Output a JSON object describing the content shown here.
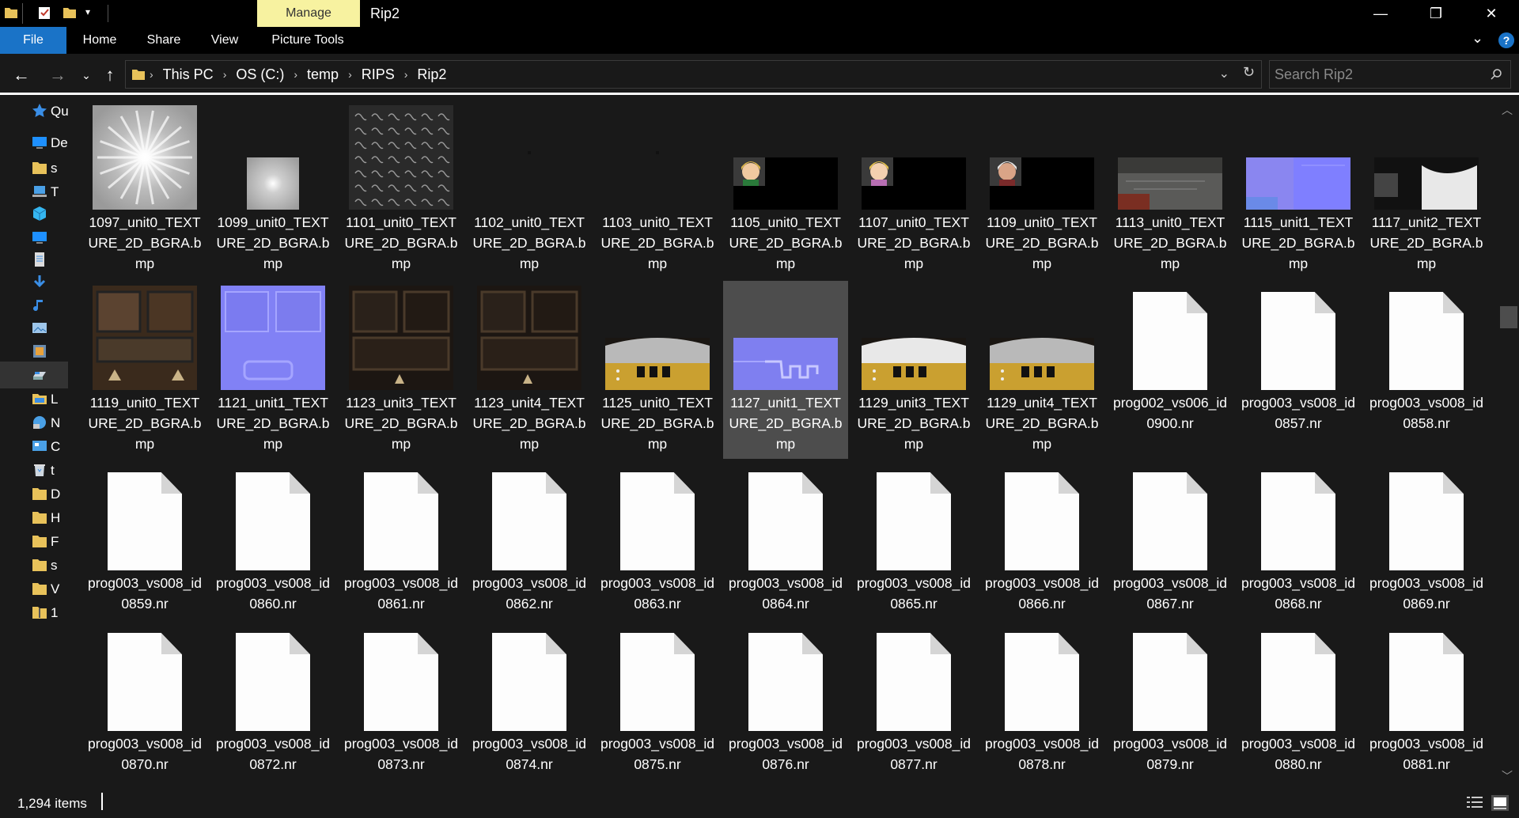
{
  "window": {
    "title": "Rip2",
    "context_tab": "Manage",
    "minimize_glyph": "—",
    "maximize_glyph": "❐",
    "close_glyph": "✕"
  },
  "ribbon": {
    "tabs": [
      "File",
      "Home",
      "Share",
      "View",
      "Picture Tools"
    ]
  },
  "address": {
    "breadcrumbs": [
      "This PC",
      "OS (C:)",
      "temp",
      "RIPS",
      "Rip2"
    ],
    "search_placeholder": "Search Rip2"
  },
  "nav": {
    "items": [
      {
        "label": "Qu",
        "icon": "star-icon",
        "color": "#3a8ee6"
      },
      {
        "label": "De",
        "icon": "desktop-icon",
        "color": "#1e90ff"
      },
      {
        "label": "s",
        "icon": "folder-icon",
        "color": "#e8c25a"
      },
      {
        "label": "T",
        "icon": "computer-icon",
        "color": "#4aa0e6"
      },
      {
        "label": "",
        "icon": "3d-objects-icon",
        "color": "#35b6f0"
      },
      {
        "label": "",
        "icon": "desktop-icon",
        "color": "#1e90ff"
      },
      {
        "label": "",
        "icon": "documents-icon",
        "color": "#dcdcdc"
      },
      {
        "label": "",
        "icon": "downloads-icon",
        "color": "#3a8ee6"
      },
      {
        "label": "",
        "icon": "music-icon",
        "color": "#3a8ee6"
      },
      {
        "label": "",
        "icon": "pictures-icon",
        "color": "#9ec6ea"
      },
      {
        "label": "",
        "icon": "videos-icon",
        "color": "#6b8cae"
      },
      {
        "label": "",
        "icon": "drive-icon",
        "color": "#cfd8e0"
      },
      {
        "label": "L",
        "icon": "library-icon",
        "color": "#e8c25a"
      },
      {
        "label": "N",
        "icon": "network-icon",
        "color": "#4aa0e6"
      },
      {
        "label": "C",
        "icon": "control-panel-icon",
        "color": "#4aa0e6"
      },
      {
        "label": "t",
        "icon": "recycle-bin-icon",
        "color": "#cfd8e0"
      },
      {
        "label": "D",
        "icon": "folder-icon",
        "color": "#e8c25a"
      },
      {
        "label": "H",
        "icon": "folder-icon",
        "color": "#e8c25a"
      },
      {
        "label": "F",
        "icon": "folder-icon",
        "color": "#e8c25a"
      },
      {
        "label": "s",
        "icon": "folder-icon",
        "color": "#e8c25a"
      },
      {
        "label": "V",
        "icon": "folder-icon",
        "color": "#e8c25a"
      },
      {
        "label": "1",
        "icon": "zip-folder-icon",
        "color": "#e8c25a"
      }
    ]
  },
  "files": [
    {
      "name": "1097_unit0_TEXTURE_2D_BGRA.bmp",
      "thumb": "radial-burst"
    },
    {
      "name": "1099_unit0_TEXTURE_2D_BGRA.bmp",
      "thumb": "gray-glow"
    },
    {
      "name": "1101_unit0_TEXTURE_2D_BGRA.bmp",
      "thumb": "glyph-grid"
    },
    {
      "name": "1102_unit0_TEXTURE_2D_BGRA.bmp",
      "thumb": "blank-dark"
    },
    {
      "name": "1103_unit0_TEXTURE_2D_BGRA.bmp",
      "thumb": "blank-dark"
    },
    {
      "name": "1105_unit0_TEXTURE_2D_BGRA.bmp",
      "thumb": "portrait-link"
    },
    {
      "name": "1107_unit0_TEXTURE_2D_BGRA.bmp",
      "thumb": "portrait-zelda"
    },
    {
      "name": "1109_unit0_TEXTURE_2D_BGRA.bmp",
      "thumb": "portrait-impa"
    },
    {
      "name": "1113_unit0_TEXTURE_2D_BGRA.bmp",
      "thumb": "grunge-texture"
    },
    {
      "name": "1115_unit1_TEXTURE_2D_BGRA.bmp",
      "thumb": "normal-map"
    },
    {
      "name": "1117_unit2_TEXTURE_2D_BGRA.bmp",
      "thumb": "bw-texture"
    },
    {
      "name": "1119_unit0_TEXTURE_2D_BGRA.bmp",
      "thumb": "wood-metal"
    },
    {
      "name": "1121_unit1_TEXTURE_2D_BGRA.bmp",
      "thumb": "normal-panels"
    },
    {
      "name": "1123_unit3_TEXTURE_2D_BGRA.bmp",
      "thumb": "dark-panels"
    },
    {
      "name": "1123_unit4_TEXTURE_2D_BGRA.bmp",
      "thumb": "dark-panels"
    },
    {
      "name": "1125_unit0_TEXTURE_2D_BGRA.bmp",
      "thumb": "blade-gold"
    },
    {
      "name": "1127_unit1_TEXTURE_2D_BGRA.bmp",
      "thumb": "normal-blade",
      "selected": true
    },
    {
      "name": "1129_unit3_TEXTURE_2D_BGRA.bmp",
      "thumb": "blade-gold-light"
    },
    {
      "name": "1129_unit4_TEXTURE_2D_BGRA.bmp",
      "thumb": "blade-gold"
    },
    {
      "name": "prog002_vs006_id0900.nr",
      "thumb": "file"
    },
    {
      "name": "prog003_vs008_id0857.nr",
      "thumb": "file"
    },
    {
      "name": "prog003_vs008_id0858.nr",
      "thumb": "file"
    },
    {
      "name": "prog003_vs008_id0859.nr",
      "thumb": "file"
    },
    {
      "name": "prog003_vs008_id0860.nr",
      "thumb": "file"
    },
    {
      "name": "prog003_vs008_id0861.nr",
      "thumb": "file"
    },
    {
      "name": "prog003_vs008_id0862.nr",
      "thumb": "file"
    },
    {
      "name": "prog003_vs008_id0863.nr",
      "thumb": "file"
    },
    {
      "name": "prog003_vs008_id0864.nr",
      "thumb": "file"
    },
    {
      "name": "prog003_vs008_id0865.nr",
      "thumb": "file"
    },
    {
      "name": "prog003_vs008_id0866.nr",
      "thumb": "file"
    },
    {
      "name": "prog003_vs008_id0867.nr",
      "thumb": "file"
    },
    {
      "name": "prog003_vs008_id0868.nr",
      "thumb": "file"
    },
    {
      "name": "prog003_vs008_id0869.nr",
      "thumb": "file"
    },
    {
      "name": "prog003_vs008_id0870.nr",
      "thumb": "file"
    },
    {
      "name": "prog003_vs008_id0872.nr",
      "thumb": "file"
    },
    {
      "name": "prog003_vs008_id0873.nr",
      "thumb": "file"
    },
    {
      "name": "prog003_vs008_id0874.nr",
      "thumb": "file"
    },
    {
      "name": "prog003_vs008_id0875.nr",
      "thumb": "file"
    },
    {
      "name": "prog003_vs008_id0876.nr",
      "thumb": "file"
    },
    {
      "name": "prog003_vs008_id0877.nr",
      "thumb": "file"
    },
    {
      "name": "prog003_vs008_id0878.nr",
      "thumb": "file"
    },
    {
      "name": "prog003_vs008_id0879.nr",
      "thumb": "file"
    },
    {
      "name": "prog003_vs008_id0880.nr",
      "thumb": "file"
    },
    {
      "name": "prog003_vs008_id0881.nr",
      "thumb": "file"
    }
  ],
  "status": {
    "item_count": "1,294 items"
  },
  "colors": {
    "background": "#191919",
    "titlebar": "#000000",
    "file_tab": "#1a73c7",
    "manage_tab": "#f7f2a0",
    "selection": "#4d4d4d"
  }
}
